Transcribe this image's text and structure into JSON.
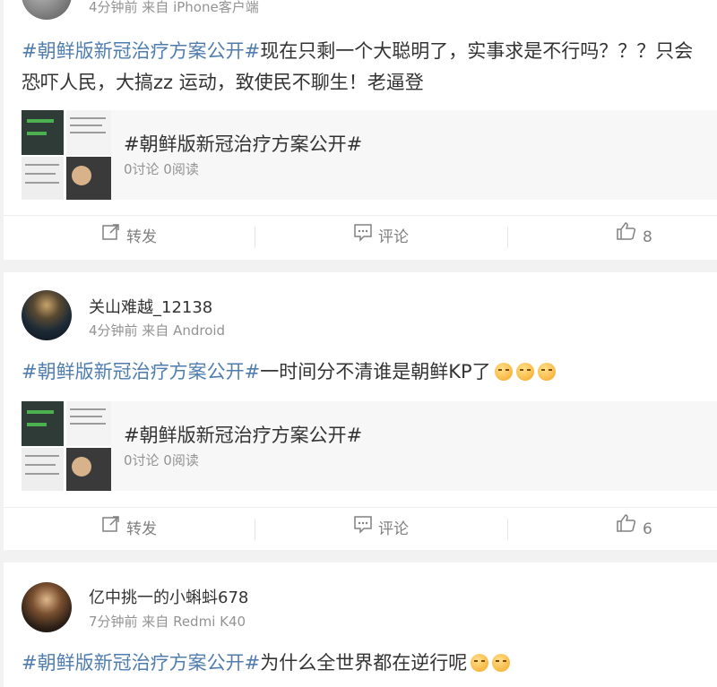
{
  "posts": [
    {
      "meta": "4分钟前 来自 iPhone客户端",
      "topic": "#朝鲜版新冠治疗方案公开#",
      "text": "现在只剩一个大聪明了，实事求是不行吗？？？只会恐吓人民，大搞zz 运动，致使民不聊生！老逼登",
      "card": {
        "title": "#朝鲜版新冠治疗方案公开#",
        "stats": "0讨论 0阅读"
      },
      "actions": {
        "repost": "转发",
        "comment": "评论",
        "likes": "8"
      }
    },
    {
      "username": "关山难越_12138",
      "meta": "4分钟前 来自 Android",
      "topic": "#朝鲜版新冠治疗方案公开#",
      "text": "一时间分不清谁是朝鲜KP了",
      "card": {
        "title": "#朝鲜版新冠治疗方案公开#",
        "stats": "0讨论 0阅读"
      },
      "actions": {
        "repost": "转发",
        "comment": "评论",
        "likes": "6"
      }
    },
    {
      "username": "亿中挑一的小蝌蚪678",
      "meta": "7分钟前 来自 Redmi K40",
      "topic": "#朝鲜版新冠治疗方案公开#",
      "text": "为什么全世界都在逆行呢"
    }
  ],
  "colors": {
    "topic": "#507daf",
    "meta": "#939393",
    "background": "#f2f2f2"
  },
  "icons": {
    "repost": "share-icon",
    "comment": "comment-icon",
    "like": "thumbs-up-icon",
    "emoji": "crying-emoji-icon"
  }
}
